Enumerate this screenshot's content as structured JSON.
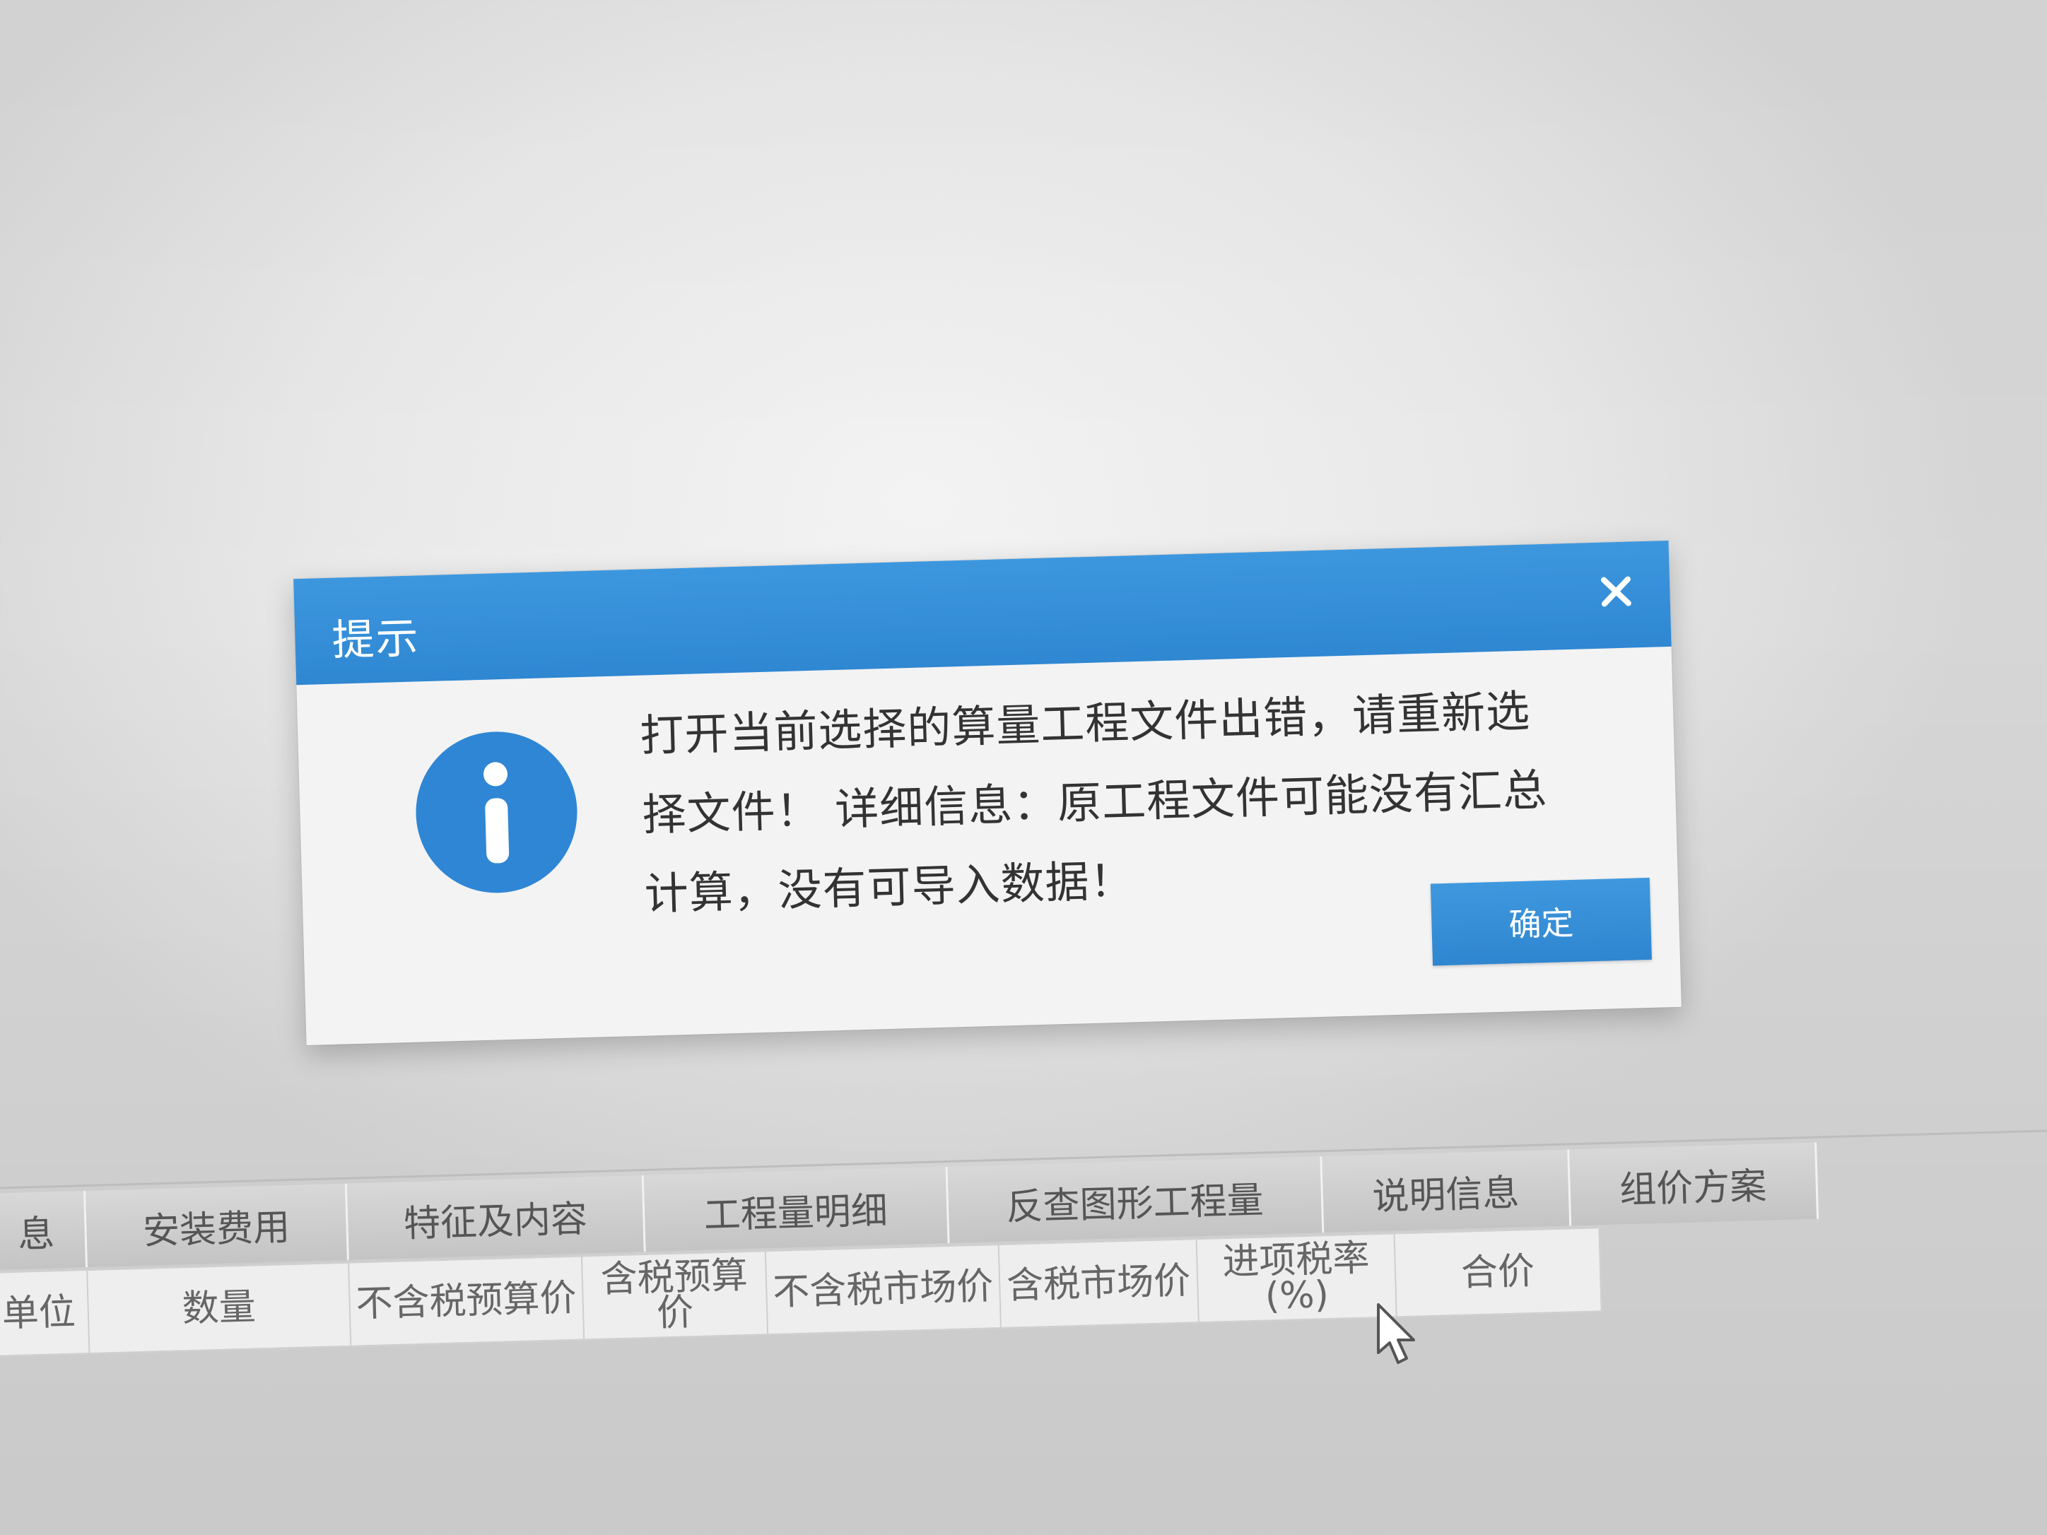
{
  "dialog": {
    "title": "提示",
    "close_icon": "close-icon",
    "icon": "info-icon",
    "message": "打开当前选择的算量工程文件出错，请重新选择文件！ 详细信息：原工程文件可能没有汇总计算，没有可导入数据！",
    "ok_label": "确定"
  },
  "tabs": [
    {
      "label": "息"
    },
    {
      "label": "安装费用"
    },
    {
      "label": "特征及内容"
    },
    {
      "label": "工程量明细"
    },
    {
      "label": "反查图形工程量"
    },
    {
      "label": "说明信息"
    },
    {
      "label": "组价方案"
    }
  ],
  "table_header": [
    {
      "label": "单位"
    },
    {
      "label": "数量"
    },
    {
      "label": "不含税预算价"
    },
    {
      "label": "含税预算价"
    },
    {
      "label": "不含税市场价"
    },
    {
      "label": "含税市场价"
    },
    {
      "label": "进项税率(%)"
    },
    {
      "label": "合价"
    }
  ],
  "colors": {
    "accent": "#2f87d2",
    "dialog_bg": "#f3f3f3",
    "tab_bg": "#c9c9c9"
  }
}
